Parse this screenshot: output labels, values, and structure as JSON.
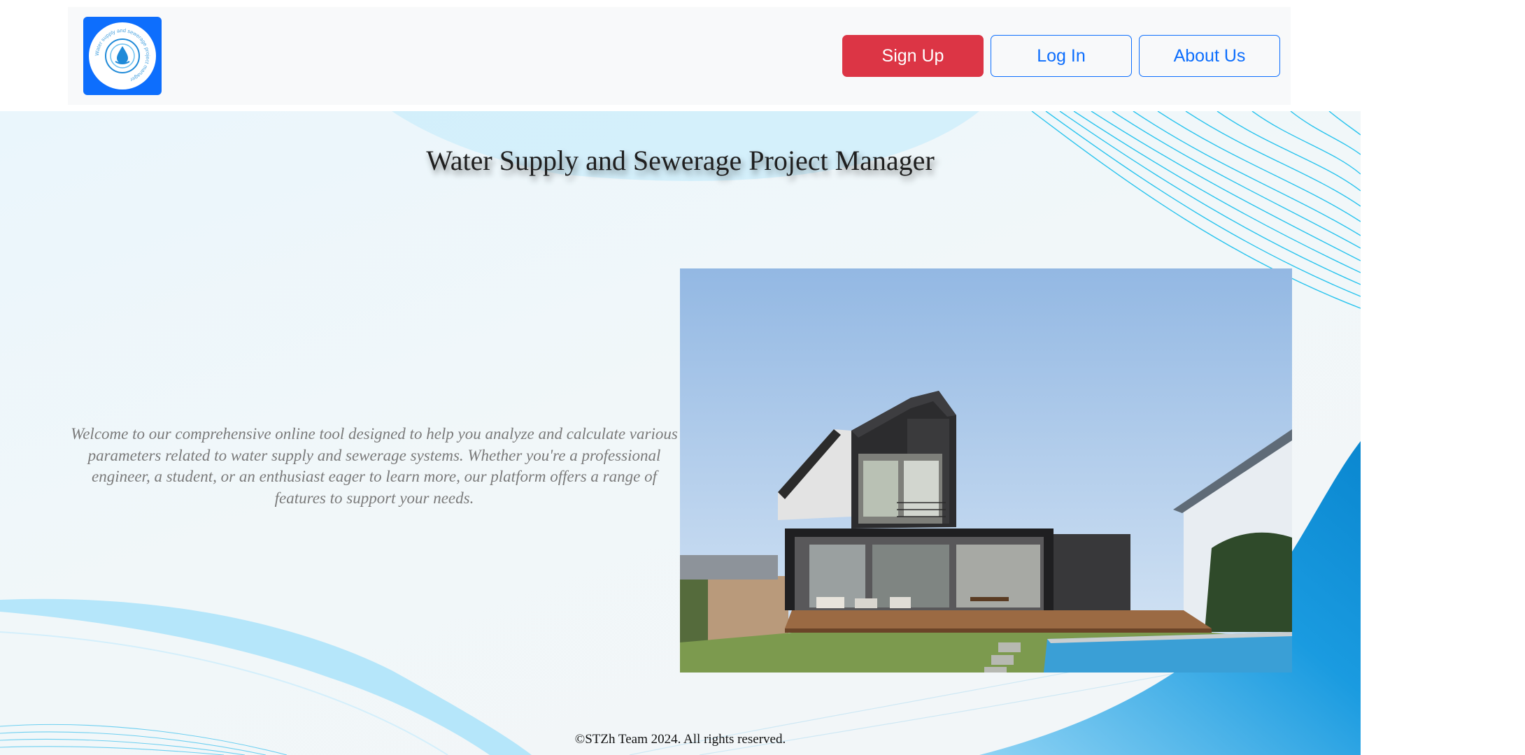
{
  "navbar": {
    "logo_text": "Water supply and sewerage project manager",
    "buttons": {
      "signup": "Sign Up",
      "login": "Log In",
      "about": "About Us"
    }
  },
  "hero": {
    "title": "Water Supply and Sewerage Project Manager",
    "intro": "Welcome to our comprehensive online tool designed to help you analyze and calculate various parameters related to water supply and sewerage systems. Whether you're a professional engineer, a student, or an enthusiast eager to learn more, our platform offers a range of features to support your needs."
  },
  "footer": {
    "copyright": "©STZh Team 2024. All rights reserved."
  },
  "colors": {
    "brand_blue": "#0d6efd",
    "signup_red": "#dc3545",
    "navbar_bg": "#f8f9fa",
    "accent_cyan": "#29c4ee",
    "wave_blue": "#0a8fd8"
  },
  "icons": [
    "water-drop-icon"
  ]
}
